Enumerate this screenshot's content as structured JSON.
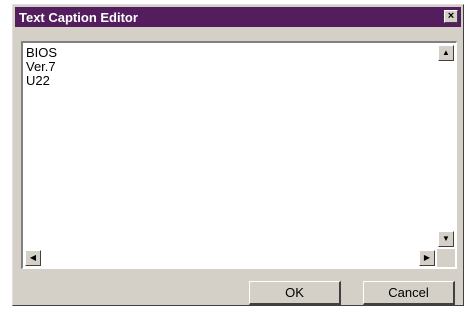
{
  "window": {
    "title": "Text Caption Editor",
    "close_glyph": "×",
    "title_bar_color": "#541e5e"
  },
  "editor": {
    "text": "BIOS\nVer.7\nU22"
  },
  "scrollbars": {
    "up_arrow": "▲",
    "down_arrow": "▼",
    "left_arrow": "◀",
    "right_arrow": "▶"
  },
  "buttons": {
    "ok_label": "OK",
    "cancel_label": "Cancel"
  }
}
